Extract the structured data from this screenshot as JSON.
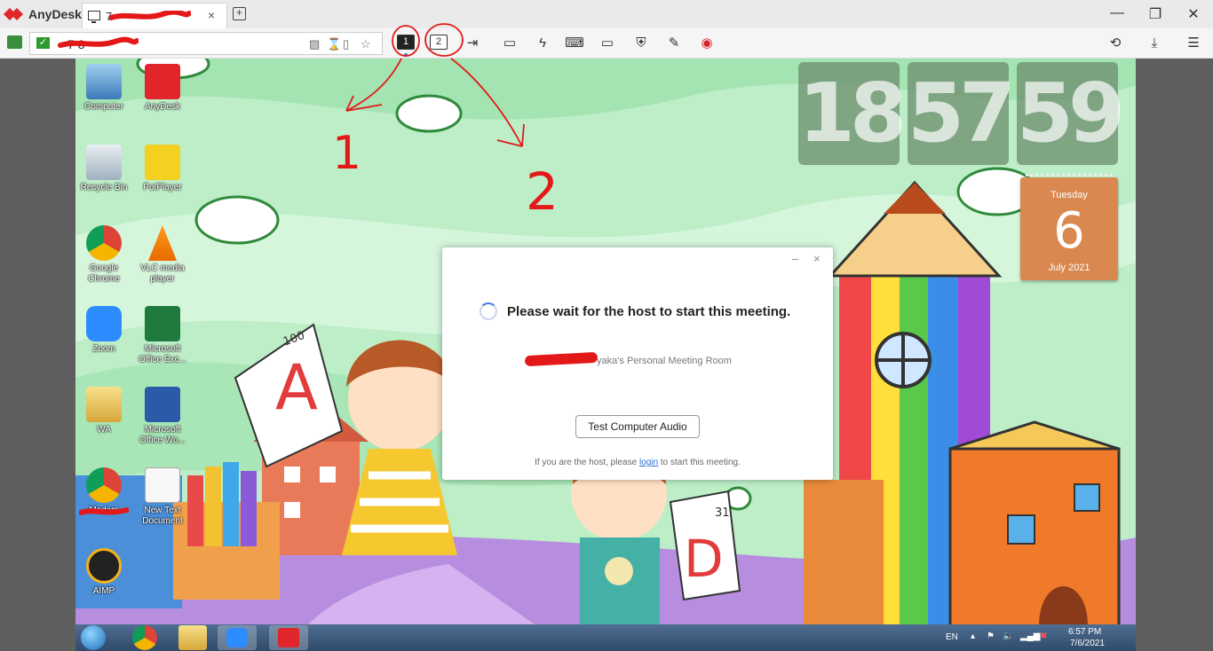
{
  "app": {
    "title": "AnyDesk",
    "tab_label": "7",
    "tab_close": "×",
    "tab_add": "+",
    "window_controls": {
      "minimize": "—",
      "maximize": "❐",
      "close": "✕"
    }
  },
  "toolbar": {
    "address_value": "7 8",
    "display_buttons": [
      {
        "label": "1"
      },
      {
        "label": "2"
      }
    ]
  },
  "remote_desktop": {
    "icons": [
      {
        "label": "Computer"
      },
      {
        "label": "AnyDesk"
      },
      {
        "label": "Recycle Bin"
      },
      {
        "label": "PotPlayer"
      },
      {
        "label": "Google Chrome"
      },
      {
        "label": "VLC media player"
      },
      {
        "label": "Zoom"
      },
      {
        "label": "Microsoft Office Exc..."
      },
      {
        "label": "WA"
      },
      {
        "label": "Microsoft Office Wo..."
      },
      {
        "label": "Madam"
      },
      {
        "label": "New Text Document"
      },
      {
        "label": "AIMP"
      }
    ],
    "clock": {
      "hours": "18",
      "minutes": "57",
      "seconds": "59"
    },
    "calendar": {
      "weekday": "Tuesday",
      "day": "6",
      "month_year": "July 2021"
    },
    "wallpaper": {
      "paper_a_grade": "A",
      "paper_a_score": "100",
      "paper_d_grade": "D",
      "paper_d_score": "31"
    }
  },
  "dialog": {
    "minimize": "–",
    "close": "×",
    "title": "Please wait for the host to start this meeting.",
    "room": "yaka's Personal Meeting Room",
    "audio_button": "Test Computer Audio",
    "footer_prefix": "If you are the host, please",
    "footer_link": "login",
    "footer_suffix": "to start this meeting."
  },
  "taskbar": {
    "language": "EN",
    "time": "6:57 PM",
    "date": "7/6/2021"
  },
  "annotations": {
    "label_1": "1",
    "label_2": "2"
  },
  "colors": {
    "anydesk_red": "#e0252b",
    "annotation_red": "#e31919",
    "link_blue": "#2a6fd6",
    "wallpaper_green": "#bdeec8",
    "taskbar": "#3a5778"
  }
}
